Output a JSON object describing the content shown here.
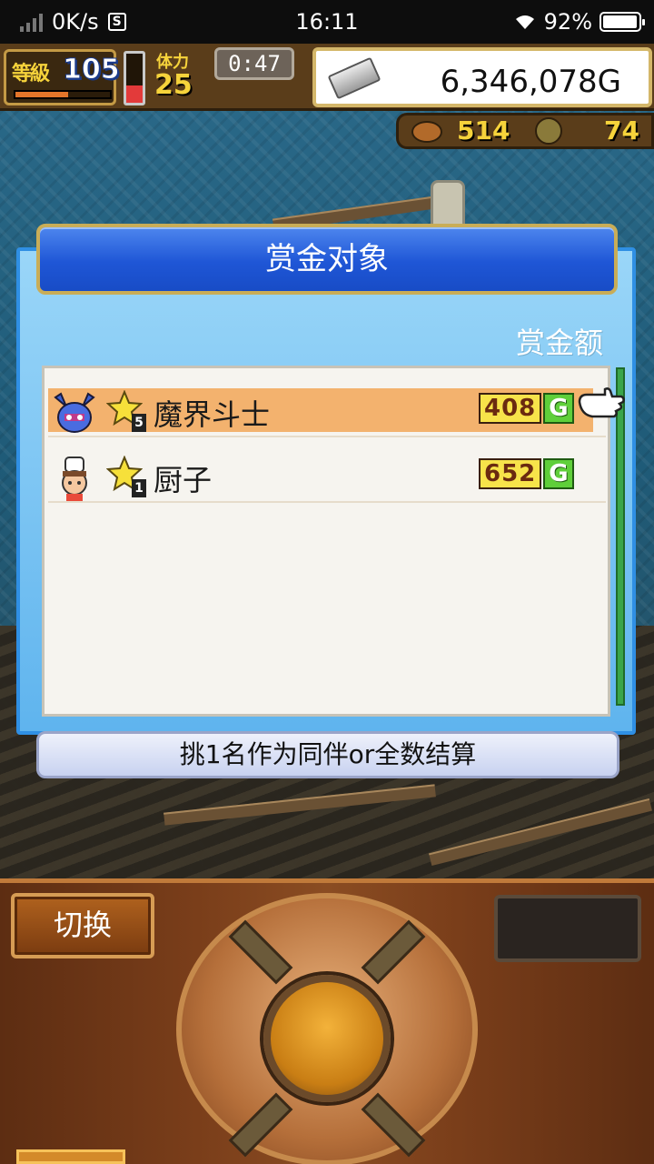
{
  "status_bar": {
    "net_speed": "0K/s",
    "sim_icon": "S",
    "time": "16:11",
    "battery": "92%"
  },
  "hud": {
    "level_label": "等級",
    "level": "105",
    "stamina_label": "体力",
    "stamina": "25",
    "timer": "0:47",
    "money": "6,346,078G",
    "resource1": "514",
    "resource2": "74"
  },
  "dialog": {
    "title": "赏金对象",
    "column_label": "赏金额",
    "rows": [
      {
        "name": "魔界斗士",
        "rank": "5",
        "bounty": "408",
        "currency": "G",
        "icon": "demon-warrior-icon",
        "selected": true
      },
      {
        "name": "厨子",
        "rank": "1",
        "bounty": "652",
        "currency": "G",
        "icon": "chef-icon",
        "selected": false
      }
    ],
    "footer": "挑1名作为同伴or全数结算"
  },
  "controls": {
    "switch_label": "切换"
  },
  "colors": {
    "dialog_bg": "#7cc4f4",
    "header_blue": "#1f56d6",
    "selected_row": "#f3b26e",
    "bounty_yellow": "#f7e34a",
    "bounty_green": "#5fcf3a"
  }
}
